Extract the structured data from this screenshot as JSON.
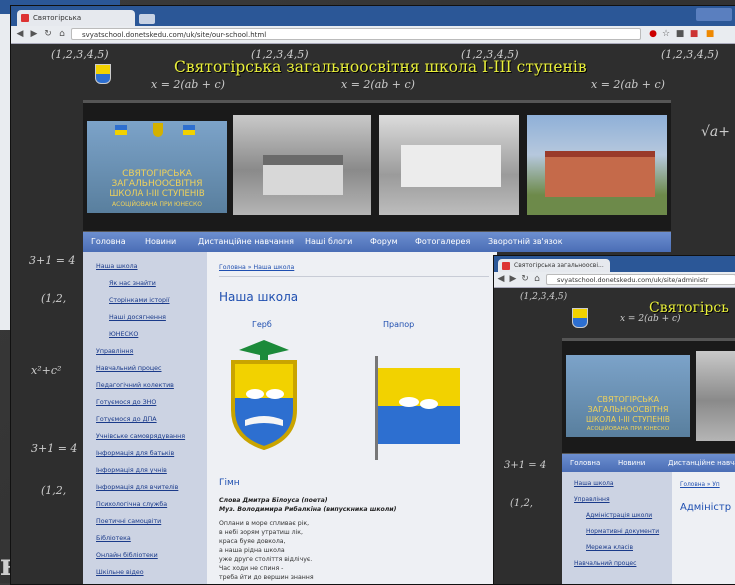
{
  "browser_main": {
    "tab_title": "Святогірська загальноосв...",
    "url": "svyatschool.donetskedu.com/uk/site/our-school.html"
  },
  "browser_second": {
    "tab_title": "Святогірська загальноосві...",
    "url": "svyatschool.donetskedu.com/uk/site/administr"
  },
  "site": {
    "title": "Святогірська загальноосвітня школа І-ІІІ ступенів",
    "title_cut": "Святогірсь",
    "sign_line1": "СВЯТОГІРСЬКА",
    "sign_line2": "ЗАГАЛЬНООСВІТНЯ",
    "sign_line3": "ШКОЛА І-ІІІ СТУПЕНІВ",
    "sign_line4": "АСОЦІЙОВАНА ПРИ ЮНЕСКО"
  },
  "menu": [
    "Головна",
    "Новини",
    "Дистанційне навчання",
    "Наші блоги",
    "Форум",
    "Фотогалерея",
    "Зворотній зв'язок"
  ],
  "menu_second": [
    "Головна",
    "Новини",
    "Дистанційне навча"
  ],
  "sidebar": [
    "Наша школа",
    "Як нас знайти",
    "Сторінками історії",
    "Наші досягнення",
    "ЮНЕСКО",
    "Управління",
    "Навчальний процес",
    "Педагогічний колектив",
    "Готуємося до ЗНО",
    "Готуємося до ДПА",
    "Учнівське самоврядування",
    "Інформація для батьків",
    "Інформація для учнів",
    "Інформація для вчителів",
    "Психологічна служба",
    "Поетичні самоцвіти",
    "Бібліотека",
    "Онлайн бібліотеки",
    "Шкільне відео"
  ],
  "sidebar_second": [
    "Наша школа",
    "Управління",
    "Адміністрація школи",
    "Нормативні документи",
    "Мережа класів",
    "Навчальний процес"
  ],
  "content": {
    "breadcrumb": "Головна » Наша школа",
    "page_title": "Наша школа",
    "gerb_label": "Герб",
    "prapor_label": "Прапор",
    "anthem_title": "Гімн",
    "credit1": "Слова Дмитра Білоуса (поета)",
    "credit2": "Муз. Володимира Рибалкіна (випускника школи)",
    "verse": [
      "Оплани в море спливає рік,",
      "в небі зорям утратиш лік,",
      "краса буяе довкола,",
      "а наша рідна школа",
      "уже друге століття відлічує.",
      "Час ходи не спиня -",
      "треба йти до вершин знання"
    ]
  },
  "content_second": {
    "breadcrumb": "Головна » Уп",
    "page_title": "Адміністр"
  },
  "chalk": {
    "eq1": "(1,2,3,4,5)",
    "eq2": "x = 2(ab + c)",
    "eq3": "3+1 = 4",
    "eq4": "(1,2,",
    "eq5": "x²+c²",
    "eq6": "√a+",
    "frag": "ня"
  }
}
